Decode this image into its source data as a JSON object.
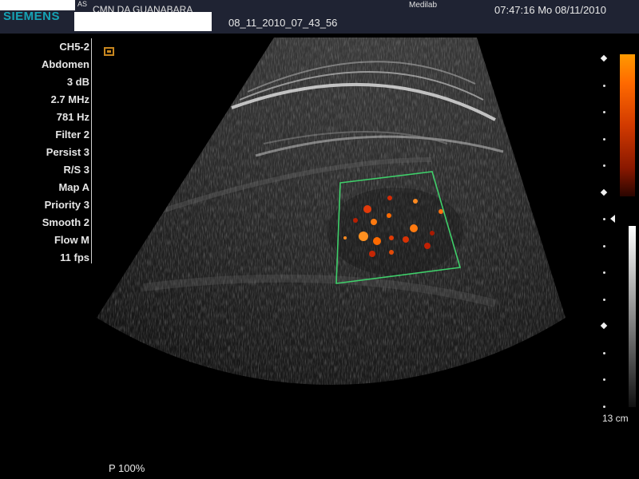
{
  "header": {
    "brand": "SIEMENS",
    "brand_sub": "AS",
    "institution": "CMN DA GUANABARA",
    "patient_id": "08_11_2010_07_43_56",
    "operator": "Medilab",
    "datetime": "07:47:16  Mo  08/11/2010"
  },
  "params": [
    "CH5-2",
    "Abdomen",
    "3 dB",
    "2.7 MHz",
    "781 Hz",
    "Filter 2",
    "Persist 3",
    "R/S 3",
    "Map A",
    "Priority 3",
    "Smooth 2",
    "Flow M",
    "11 fps"
  ],
  "depth_label": "13 cm",
  "power": "P 100%",
  "colors": {
    "roi_box": "#3fcf6a",
    "header_bg": "#1f2333",
    "brand": "#16a3b5",
    "flow_hot": "#ff6a00"
  },
  "icons": [
    "probe-orientation-icon",
    "focus-marker-icon"
  ]
}
